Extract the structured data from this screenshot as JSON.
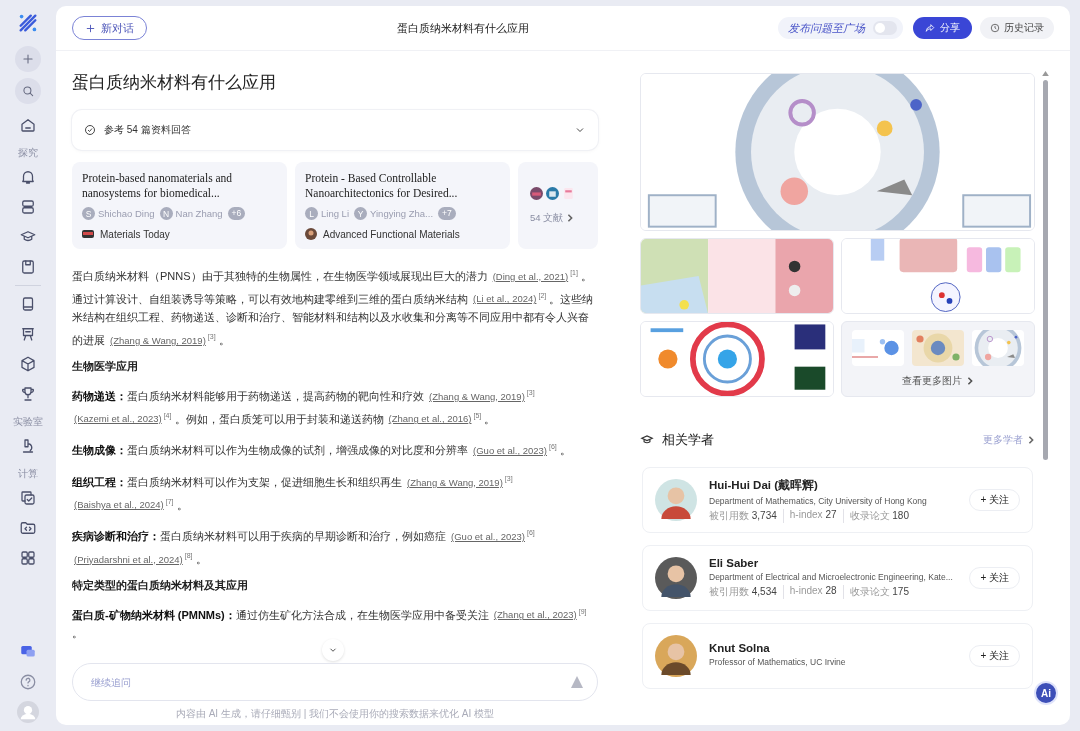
{
  "sidebar": {
    "sections": [
      "探究",
      "实验室",
      "计算"
    ]
  },
  "topbar": {
    "new_chat": "新对话",
    "title": "蛋白质纳米材料有什么应用",
    "publish": {
      "label": "发布问题至广场",
      "on": false
    },
    "share": "分享",
    "history": "历史记录"
  },
  "question": "蛋白质纳米材料有什么应用",
  "references": {
    "label": "参考 54 篇资料回答",
    "expanded": false
  },
  "papers": [
    {
      "title": "Protein-based nanomaterials and nanosystems for biomedical...",
      "authors": [
        {
          "initial": "S",
          "name": "Shichao Ding"
        },
        {
          "initial": "N",
          "name": "Nan Zhang"
        }
      ],
      "more": "+6",
      "journal": "Materials Today"
    },
    {
      "title": "Protein - Based Controllable Nanoarchitectonics for Desired...",
      "authors": [
        {
          "initial": "L",
          "name": "Ling Li"
        },
        {
          "initial": "Y",
          "name": "Yingying Zha..."
        }
      ],
      "more": "+7",
      "journal": "Advanced Functional Materials"
    }
  ],
  "more_papers": "54 文献",
  "answer": [
    {
      "kind": "paragraph",
      "parts": [
        {
          "kind": "text",
          "text": "蛋白质纳米材料（PNNS）由于其独特的生物属性，在生物医学领域展现出巨大的潜力 "
        },
        {
          "kind": "cite",
          "text": "(Ding et al., 2021)"
        },
        {
          "kind": "ref",
          "text": "[1]"
        },
        {
          "kind": "text",
          "text": " 。通过计算设计、自组装诱导等策略，可以有效地构建零维到三维的蛋白质纳米结构 "
        },
        {
          "kind": "cite",
          "text": "(Li et al., 2024)"
        },
        {
          "kind": "ref",
          "text": "[2]"
        },
        {
          "kind": "text",
          "text": " 。这些纳米结构在组织工程、药物递送、诊断和治疗、智能材料和结构以及水收集和分离等不同应用中都有令人兴奋的进展 "
        },
        {
          "kind": "cite",
          "text": "(Zhang & Wang, 2019)"
        },
        {
          "kind": "ref",
          "text": "[3]"
        },
        {
          "kind": "text",
          "text": " 。"
        }
      ]
    },
    {
      "kind": "heading",
      "text": "生物医学应用"
    },
    {
      "kind": "paragraph",
      "lead": "药物递送：",
      "parts": [
        {
          "kind": "text",
          "text": "蛋白质纳米材料能够用于药物递送，提高药物的靶向性和疗效 "
        },
        {
          "kind": "cite",
          "text": "(Zhang & Wang, 2019)"
        },
        {
          "kind": "ref",
          "text": "[3]"
        },
        {
          "kind": "cite",
          "text": "(Kazemi et al., 2023)"
        },
        {
          "kind": "ref",
          "text": "[4]"
        },
        {
          "kind": "text",
          "text": " 。例如，蛋白质笼可以用于封装和递送药物 "
        },
        {
          "kind": "cite",
          "text": "(Zhang et al., 2016)"
        },
        {
          "kind": "ref",
          "text": "[5]"
        },
        {
          "kind": "text",
          "text": " 。"
        }
      ]
    },
    {
      "kind": "paragraph",
      "lead": "生物成像：",
      "parts": [
        {
          "kind": "text",
          "text": "蛋白质纳米材料可以作为生物成像的试剂，增强成像的对比度和分辨率 "
        },
        {
          "kind": "cite",
          "text": "(Guo et al., 2023)"
        },
        {
          "kind": "ref",
          "text": "[6]"
        },
        {
          "kind": "text",
          "text": " 。"
        }
      ]
    },
    {
      "kind": "paragraph",
      "lead": "组织工程：",
      "parts": [
        {
          "kind": "text",
          "text": "蛋白质纳米材料可以作为支架，促进细胞生长和组织再生 "
        },
        {
          "kind": "cite",
          "text": "(Zhang & Wang, 2019)"
        },
        {
          "kind": "ref",
          "text": "[3]"
        },
        {
          "kind": "cite",
          "text": "(Baishya et al., 2024)"
        },
        {
          "kind": "ref",
          "text": "[7]"
        },
        {
          "kind": "text",
          "text": " 。"
        }
      ]
    },
    {
      "kind": "paragraph",
      "lead": "疾病诊断和治疗：",
      "parts": [
        {
          "kind": "text",
          "text": "蛋白质纳米材料可以用于疾病的早期诊断和治疗，例如癌症 "
        },
        {
          "kind": "cite",
          "text": "(Guo et al., 2023)"
        },
        {
          "kind": "ref",
          "text": "[6]"
        },
        {
          "kind": "cite",
          "text": "(Priyadarshni et al., 2024)"
        },
        {
          "kind": "ref",
          "text": "[8]"
        },
        {
          "kind": "text",
          "text": " 。"
        }
      ]
    },
    {
      "kind": "heading",
      "text": "特定类型的蛋白质纳米材料及其应用"
    },
    {
      "kind": "paragraph",
      "lead": "蛋白质-矿物纳米材料 (PMNMs)：",
      "parts": [
        {
          "kind": "text",
          "text": "通过仿生矿化方法合成，在生物医学应用中备受关注 "
        },
        {
          "kind": "cite",
          "text": "(Zhang et al., 2023)"
        },
        {
          "kind": "ref",
          "text": "[9]"
        },
        {
          "kind": "text",
          "text": " 。"
        }
      ]
    }
  ],
  "input": {
    "placeholder": "继续追问"
  },
  "footer": "内容由 AI 生成，请仔细甄别 | 我们不会使用你的搜索数据来优化 AI 模型",
  "gallery": {
    "main": {
      "kind": "picture"
    },
    "thumbs": [
      {
        "kind": "picture"
      },
      {
        "kind": "picture"
      },
      {
        "kind": "picture"
      }
    ],
    "more": {
      "previews": [
        {
          "kind": "picture"
        },
        {
          "kind": "picture"
        },
        {
          "kind": "picture"
        }
      ],
      "label": "查看更多图片"
    }
  },
  "scholars": {
    "title": "相关学者",
    "more": "更多学者",
    "items": [
      {
        "avatar": {
          "kind": "picture"
        },
        "name": "Hui-Hui Dai (戴晖辉)",
        "affiliation": "Department of Mathematics, City University of Hong Kong",
        "stats": [
          {
            "label": "被引用数",
            "value": "3,734"
          },
          {
            "label": "h-index",
            "value": "27"
          },
          {
            "label": "收录论文",
            "value": "180"
          }
        ],
        "follow": "+ 关注"
      },
      {
        "avatar": {
          "kind": "picture"
        },
        "name": "Eli Saber",
        "affiliation": "Department of Electrical and Microelectronic Engineering, Kate...",
        "stats": [
          {
            "label": "被引用数",
            "value": "4,534"
          },
          {
            "label": "h-index",
            "value": "28"
          },
          {
            "label": "收录论文",
            "value": "175"
          }
        ],
        "follow": "+ 关注"
      },
      {
        "avatar": {
          "kind": "picture"
        },
        "name": "Knut Solna",
        "affiliation": "Professor of Mathematics, UC Irvine",
        "follow": "+ 关注"
      }
    ]
  },
  "ai_button": "Ai"
}
